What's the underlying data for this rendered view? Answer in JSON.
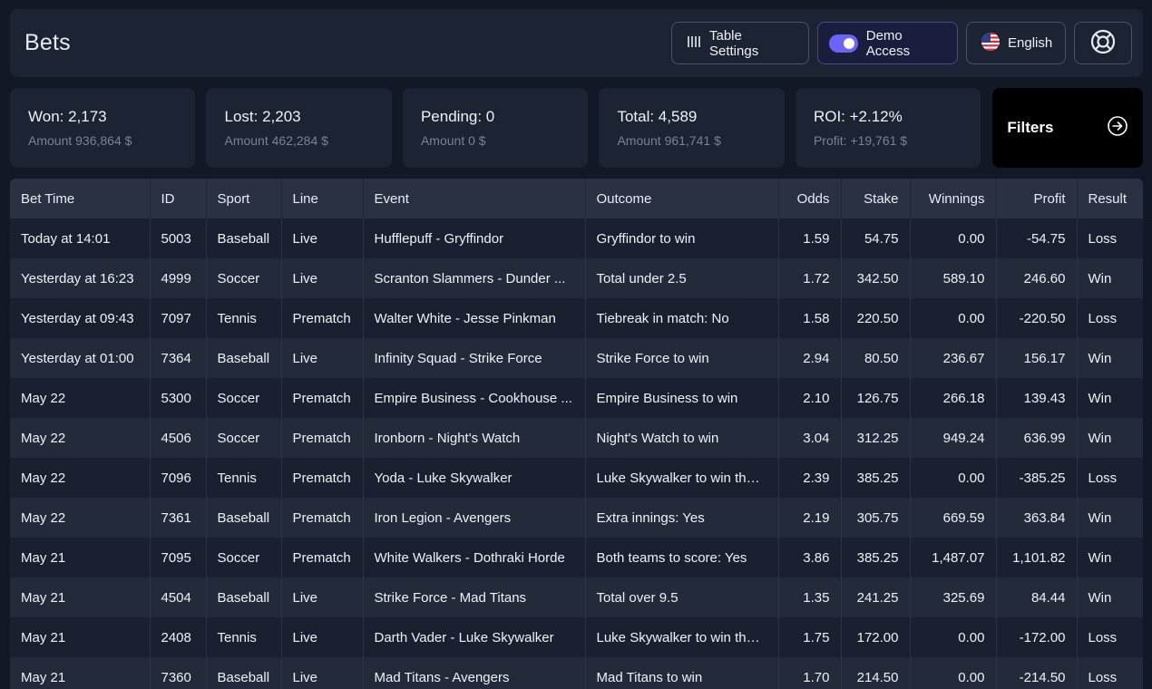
{
  "header": {
    "title": "Bets",
    "table_settings_label": "Table Settings",
    "demo_access_label": "Demo Access",
    "language_label": "English"
  },
  "stats": [
    {
      "main": "Won: 2,173",
      "sub": "Amount 936,864 $"
    },
    {
      "main": "Lost: 2,203",
      "sub": "Amount 462,284 $"
    },
    {
      "main": "Pending: 0",
      "sub": "Amount 0 $"
    },
    {
      "main": "Total: 4,589",
      "sub": "Amount 961,741 $"
    },
    {
      "main": "ROI: +2.12%",
      "sub": "Profit: +19,761 $"
    }
  ],
  "filters_label": "Filters",
  "table": {
    "columns": [
      "Bet Time",
      "ID",
      "Sport",
      "Line",
      "Event",
      "Outcome",
      "Odds",
      "Stake",
      "Winnings",
      "Profit",
      "Result"
    ],
    "rows": [
      [
        "Today at 14:01",
        "5003",
        "Baseball",
        "Live",
        "Hufflepuff - Gryffindor",
        "Gryffindor to win",
        "1.59",
        "54.75",
        "0.00",
        "-54.75",
        "Loss"
      ],
      [
        "Yesterday at 16:23",
        "4999",
        "Soccer",
        "Live",
        "Scranton Slammers - Dunder ...",
        "Total under 2.5",
        "1.72",
        "342.50",
        "589.10",
        "246.60",
        "Win"
      ],
      [
        "Yesterday at 09:43",
        "7097",
        "Tennis",
        "Prematch",
        "Walter White - Jesse Pinkman",
        "Tiebreak in match: No",
        "1.58",
        "220.50",
        "0.00",
        "-220.50",
        "Loss"
      ],
      [
        "Yesterday at 01:00",
        "7364",
        "Baseball",
        "Live",
        "Infinity Squad - Strike Force",
        "Strike Force to win",
        "2.94",
        "80.50",
        "236.67",
        "156.17",
        "Win"
      ],
      [
        "May 22",
        "5300",
        "Soccer",
        "Prematch",
        "Empire Business - Cookhouse ...",
        "Empire Business to win",
        "2.10",
        "126.75",
        "266.18",
        "139.43",
        "Win"
      ],
      [
        "May 22",
        "4506",
        "Soccer",
        "Prematch",
        "Ironborn - Night's Watch",
        "Night's Watch to win",
        "3.04",
        "312.25",
        "949.24",
        "636.99",
        "Win"
      ],
      [
        "May 22",
        "7096",
        "Tennis",
        "Prematch",
        "Yoda - Luke Skywalker",
        "Luke Skywalker to win the ...",
        "2.39",
        "385.25",
        "0.00",
        "-385.25",
        "Loss"
      ],
      [
        "May 22",
        "7361",
        "Baseball",
        "Prematch",
        "Iron Legion - Avengers",
        "Extra innings: Yes",
        "2.19",
        "305.75",
        "669.59",
        "363.84",
        "Win"
      ],
      [
        "May 21",
        "7095",
        "Soccer",
        "Prematch",
        "White Walkers - Dothraki Horde",
        "Both teams to score: Yes",
        "3.86",
        "385.25",
        "1,487.07",
        "1,101.82",
        "Win"
      ],
      [
        "May 21",
        "4504",
        "Baseball",
        "Live",
        "Strike Force - Mad Titans",
        "Total over 9.5",
        "1.35",
        "241.25",
        "325.69",
        "84.44",
        "Win"
      ],
      [
        "May 21",
        "2408",
        "Tennis",
        "Live",
        "Darth Vader - Luke Skywalker",
        "Luke Skywalker to win the ...",
        "1.75",
        "172.00",
        "0.00",
        "-172.00",
        "Loss"
      ],
      [
        "May 21",
        "7360",
        "Baseball",
        "Live",
        "Mad Titans - Avengers",
        "Mad Titans to win",
        "1.70",
        "214.50",
        "0.00",
        "-214.50",
        "Loss"
      ]
    ]
  }
}
